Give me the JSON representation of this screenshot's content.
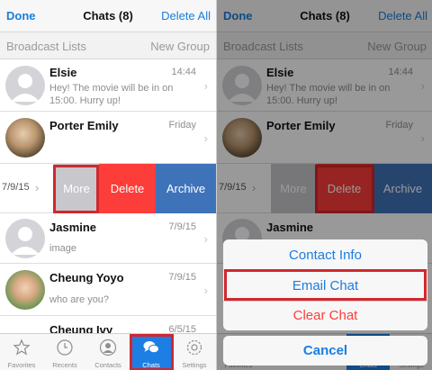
{
  "navbar": {
    "done": "Done",
    "title": "Chats (8)",
    "delete_all": "Delete All"
  },
  "subbar": {
    "broadcast": "Broadcast Lists",
    "new_group": "New Group"
  },
  "chats": [
    {
      "name": "Elsie",
      "date": "14:44",
      "message": "Hey! The movie will be in on 15:00. Hurry up!"
    },
    {
      "name": "Porter Emily",
      "date": "Friday",
      "message": ""
    },
    {
      "name": "",
      "date": "7/9/15",
      "message": ""
    },
    {
      "name": "Jasmine",
      "date": "7/9/15",
      "message": "image"
    },
    {
      "name": "Cheung Yoyo",
      "date": "7/9/15",
      "message": "who are you?"
    },
    {
      "name": "Cheung Ivy",
      "date": "6/5/15",
      "message": ""
    }
  ],
  "swipe_actions": {
    "more": "More",
    "delete": "Delete",
    "archive": "Archive"
  },
  "tabs": [
    {
      "label": "Favorites",
      "icon": "star-icon"
    },
    {
      "label": "Recents",
      "icon": "clock-icon"
    },
    {
      "label": "Contacts",
      "icon": "person-icon"
    },
    {
      "label": "Chats",
      "icon": "chat-bubbles-icon"
    },
    {
      "label": "Settings",
      "icon": "gear-icon"
    }
  ],
  "action_sheet": {
    "contact_info": "Contact Info",
    "email_chat": "Email Chat",
    "clear_chat": "Clear Chat",
    "cancel": "Cancel"
  },
  "colors": {
    "accent": "#1a7ee0",
    "delete": "#fc3d39",
    "archive": "#3e73b9",
    "more": "#c7c7cc",
    "highlight": "#d1272d"
  }
}
